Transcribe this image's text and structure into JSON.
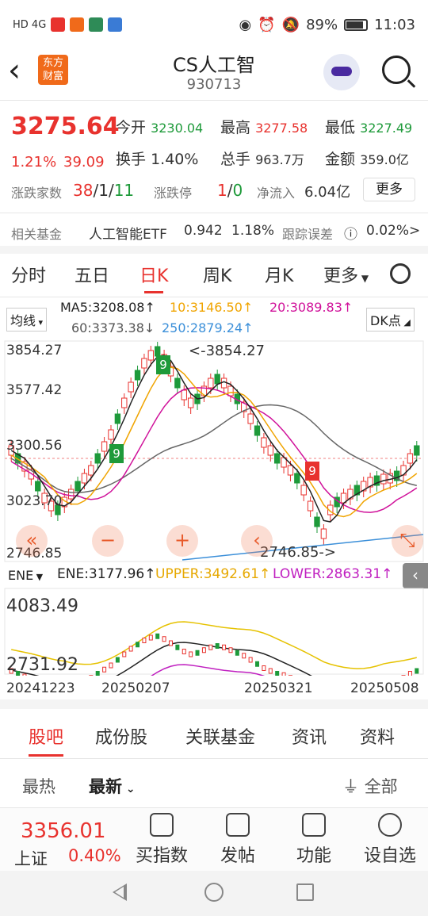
{
  "status": {
    "net": "HD 4G",
    "battery": "89%",
    "time": "11:03"
  },
  "header": {
    "logo": "东方财富",
    "title": "CS人工智",
    "code": "930713"
  },
  "quote": {
    "price": "3275.64",
    "pct": "1.21%",
    "change": "39.09",
    "open_label": "今开",
    "open": "3230.04",
    "high_label": "最高",
    "high": "3277.58",
    "low_label": "最低",
    "low": "3227.49",
    "turnover_label": "换手",
    "turnover": "1.40%",
    "volume_label": "总手",
    "volume": "963.7万",
    "amount_label": "金额",
    "amount": "359.0亿",
    "updown_label": "涨跌家数",
    "up": "38",
    "sep1": "/",
    "flat": "1",
    "sep2": "/",
    "down": "11",
    "limit_label": "涨跌停",
    "limit_up": "1",
    "sep3": "/",
    "limit_down": "0",
    "netflow_label": "净流入",
    "netflow": "6.04亿",
    "more": "更多",
    "fund_label": "相关基金",
    "fund_name": "人工智能ETF",
    "fund_price": "0.942",
    "fund_pct": "1.18%",
    "track_label": "跟踪误差",
    "track_value": "0.02%",
    "track_arrow": ">"
  },
  "ktabs": [
    "分时",
    "五日",
    "日K",
    "周K",
    "月K",
    "更多"
  ],
  "ma": {
    "select": "均线",
    "ma5": "MA5:3208.08↑",
    "ma10": "10:3146.50↑",
    "ma20": "20:3089.83↑",
    "ma60": "60:3373.38↓",
    "ma250": "250:2879.24↑",
    "dk": "DK点"
  },
  "main_chart": {
    "y_top": "3854.27",
    "y2": "3577.42",
    "y3": "3300.56",
    "y4": "3023.70",
    "y_bottom": "2746.85",
    "high_mark": "<-3854.27",
    "low_mark": "2746.85->",
    "nine1": "9",
    "nine2": "9",
    "nine3": "9"
  },
  "ene": {
    "select": "ENE",
    "ene": "ENE:3177.96↑",
    "upper": "UPPER:3492.61↑",
    "lower": "LOWER:2863.31↑",
    "y_top": "4083.49",
    "y_bottom": "2731.92"
  },
  "dates": [
    "20241223",
    "20250207",
    "20250321",
    "20250508"
  ],
  "section_tabs": [
    "股吧",
    "成份股",
    "关联基金",
    "资讯",
    "资料"
  ],
  "sub_tabs": {
    "hot": "最热",
    "new": "最新",
    "filter": "全部"
  },
  "bottom": {
    "index_price": "3356.01",
    "index_name": "上证",
    "index_pct": "0.40%",
    "items": [
      "买指数",
      "发帖",
      "功能",
      "设自选"
    ]
  },
  "colors": {
    "up": "#e8322e",
    "down": "#1e9a3a",
    "ma10": "#f0a400",
    "ma20": "#d0119a",
    "ma250": "#3b8fd9"
  }
}
